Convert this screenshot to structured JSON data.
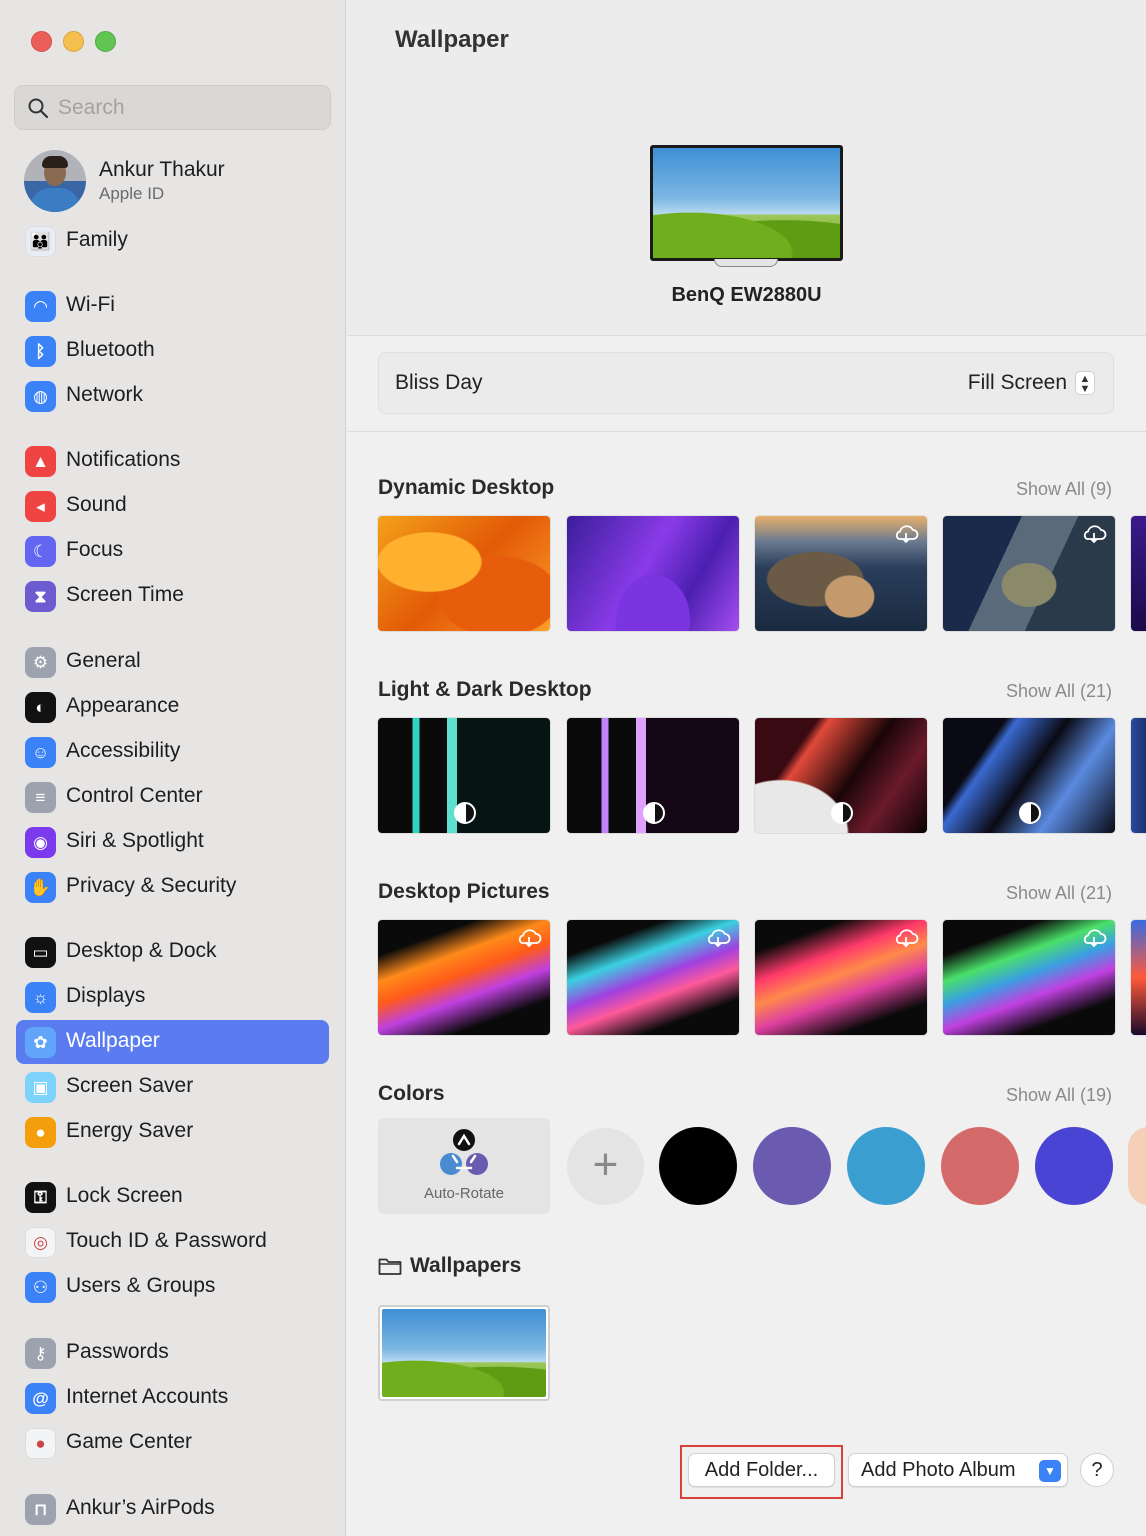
{
  "search": {
    "placeholder": "Search"
  },
  "profile": {
    "name": "Ankur Thakur",
    "subtitle": "Apple ID"
  },
  "sidebar": {
    "items": [
      {
        "label": "Family",
        "icon": "family-icon",
        "color": "#e8ecf5"
      },
      {
        "label": "Wi-Fi",
        "icon": "wifi-icon",
        "color": "#3b82f6"
      },
      {
        "label": "Bluetooth",
        "icon": "bluetooth-icon",
        "color": "#3b82f6"
      },
      {
        "label": "Network",
        "icon": "globe-icon",
        "color": "#3b82f6"
      },
      {
        "label": "Notifications",
        "icon": "bell-icon",
        "color": "#ef4444"
      },
      {
        "label": "Sound",
        "icon": "speaker-icon",
        "color": "#ef4444"
      },
      {
        "label": "Focus",
        "icon": "moon-icon",
        "color": "#6366f1"
      },
      {
        "label": "Screen Time",
        "icon": "hourglass-icon",
        "color": "#6d5bd0"
      },
      {
        "label": "General",
        "icon": "gear-icon",
        "color": "#9ca3af"
      },
      {
        "label": "Appearance",
        "icon": "appearance-icon",
        "color": "#111111"
      },
      {
        "label": "Accessibility",
        "icon": "accessibility-icon",
        "color": "#3b82f6"
      },
      {
        "label": "Control Center",
        "icon": "toggles-icon",
        "color": "#9ca3af"
      },
      {
        "label": "Siri & Spotlight",
        "icon": "siri-icon",
        "color": "#7c3aed"
      },
      {
        "label": "Privacy & Security",
        "icon": "hand-icon",
        "color": "#3b82f6"
      },
      {
        "label": "Desktop & Dock",
        "icon": "dock-icon",
        "color": "#111111"
      },
      {
        "label": "Displays",
        "icon": "sun-icon",
        "color": "#3b82f6"
      },
      {
        "label": "Wallpaper",
        "icon": "flower-icon",
        "color": "#60a5fa"
      },
      {
        "label": "Screen Saver",
        "icon": "screensaver-icon",
        "color": "#7dd3fc"
      },
      {
        "label": "Energy Saver",
        "icon": "bulb-icon",
        "color": "#f59e0b"
      },
      {
        "label": "Lock Screen",
        "icon": "lock-icon",
        "color": "#111111"
      },
      {
        "label": "Touch ID & Password",
        "icon": "fingerprint-icon",
        "color": "#f3f4f6"
      },
      {
        "label": "Users & Groups",
        "icon": "users-icon",
        "color": "#3b82f6"
      },
      {
        "label": "Passwords",
        "icon": "key-icon",
        "color": "#9ca3af"
      },
      {
        "label": "Internet Accounts",
        "icon": "at-icon",
        "color": "#3b82f6"
      },
      {
        "label": "Game Center",
        "icon": "gamecenter-icon",
        "color": "#f3f4f6"
      },
      {
        "label": "Ankur’s AirPods",
        "icon": "airpods-icon",
        "color": "#9ca3af"
      }
    ]
  },
  "main": {
    "title": "Wallpaper",
    "monitor_name": "BenQ EW2880U",
    "current_wallpaper": "Bliss Day",
    "fill_mode": "Fill Screen",
    "sections": {
      "dynamic": {
        "title": "Dynamic Desktop",
        "show_all": "Show All (9)"
      },
      "lightdark": {
        "title": "Light & Dark Desktop",
        "show_all": "Show All (21)"
      },
      "pictures": {
        "title": "Desktop Pictures",
        "show_all": "Show All (21)"
      },
      "colors": {
        "title": "Colors",
        "show_all": "Show All (19)",
        "auto_rotate": "Auto-Rotate",
        "add_symbol": "+",
        "swatches": [
          "#000000",
          "#6a5bb0",
          "#3a9fd0",
          "#d46a6a",
          "#4a44d4"
        ]
      },
      "folder": {
        "title": "Wallpapers"
      }
    }
  },
  "footer": {
    "add_folder": "Add Folder...",
    "add_album": "Add Photo Album",
    "help": "?"
  }
}
